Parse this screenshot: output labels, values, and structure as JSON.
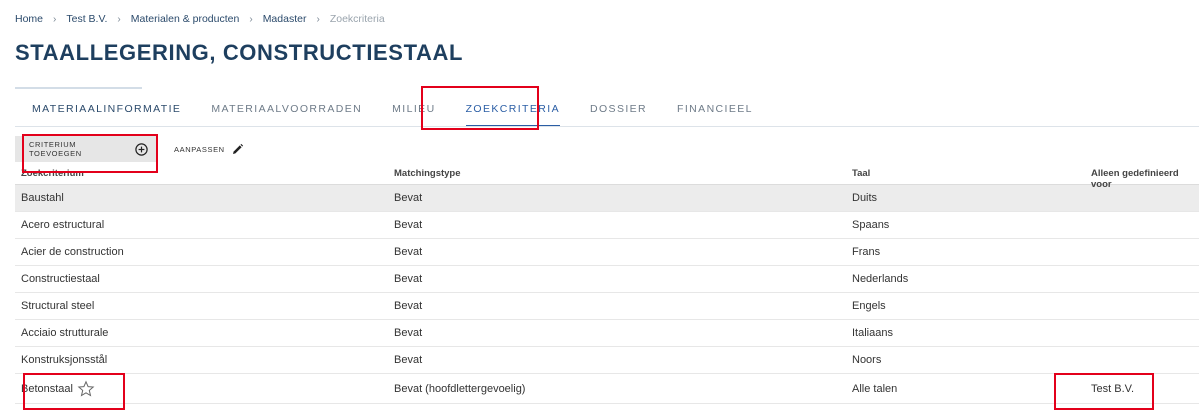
{
  "breadcrumb": [
    {
      "label": "Home"
    },
    {
      "label": "Test B.V."
    },
    {
      "label": "Materialen & producten"
    },
    {
      "label": "Madaster"
    },
    {
      "label": "Zoekcriteria"
    }
  ],
  "page_title": "STAALLEGERING, CONSTRUCTIESTAAL",
  "tabs": [
    {
      "label": "MATERIAALINFORMATIE"
    },
    {
      "label": "MATERIAALVOORRADEN"
    },
    {
      "label": "MILIEU"
    },
    {
      "label": "ZOEKCRITERIA",
      "active": true
    },
    {
      "label": "DOSSIER"
    },
    {
      "label": "FINANCIEEL"
    }
  ],
  "toolbar": {
    "add_criterion_label": "CRITERIUM TOEVOEGEN",
    "add_criterion_icon": "plus-circle-icon",
    "edit_label": "AANPASSEN",
    "edit_icon": "pencil-icon"
  },
  "table": {
    "headers": [
      "Zoekcriterium",
      "Matchingstype",
      "Taal",
      "Alleen gedefinieerd voor"
    ],
    "rows": [
      {
        "criterion": "Baustahl",
        "matching": "Bevat",
        "language": "Duits",
        "defined_for": ""
      },
      {
        "criterion": "Acero estructural",
        "matching": "Bevat",
        "language": "Spaans",
        "defined_for": ""
      },
      {
        "criterion": "Acier de construction",
        "matching": "Bevat",
        "language": "Frans",
        "defined_for": ""
      },
      {
        "criterion": "Constructiestaal",
        "matching": "Bevat",
        "language": "Nederlands",
        "defined_for": ""
      },
      {
        "criterion": "Structural steel",
        "matching": "Bevat",
        "language": "Engels",
        "defined_for": ""
      },
      {
        "criterion": "Acciaio strutturale",
        "matching": "Bevat",
        "language": "Italiaans",
        "defined_for": ""
      },
      {
        "criterion": "Konstruksjonsstål",
        "matching": "Bevat",
        "language": "Noors",
        "defined_for": ""
      },
      {
        "criterion": "Betonstaal",
        "matching": "Bevat (hoofdlettergevoelig)",
        "language": "Alle talen",
        "defined_for": "Test B.V.",
        "icon": "star-outline-icon"
      }
    ]
  },
  "colors": {
    "title": "#1e3f5f",
    "active_tab": "#2b5ea5",
    "highlight_box": "#e3001b",
    "row_highlight": "#ececec"
  }
}
